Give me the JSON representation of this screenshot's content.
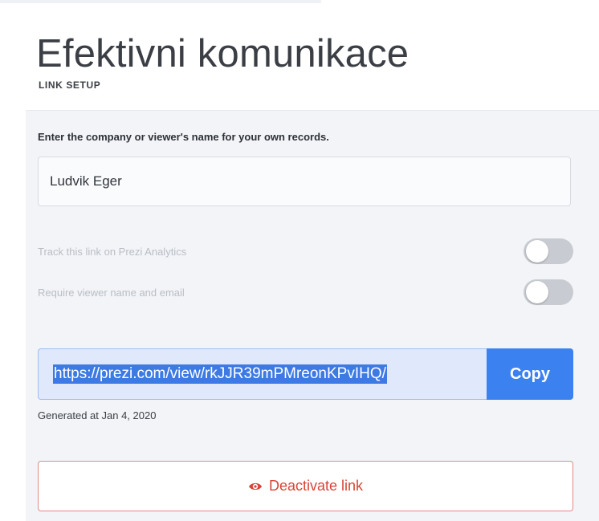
{
  "page": {
    "title": "Efektivni komunikace"
  },
  "link_setup": {
    "section_label": "LINK SETUP",
    "prompt": "Enter the company or viewer's name for your own records.",
    "name_value": "Ludvik Eger",
    "toggles": [
      {
        "label": "Track this link on Prezi Analytics",
        "state": "off"
      },
      {
        "label": "Require viewer name and email",
        "state": "off"
      }
    ],
    "link_url": "https://prezi.com/view/rkJJR39mPMreonKPvIHQ/",
    "copy_label": "Copy",
    "generated_text": "Generated at Jan 4, 2020",
    "deactivate_icon": "eye-icon",
    "deactivate_label": "Deactivate link"
  },
  "colors": {
    "accent_blue": "#3b82f0",
    "selection_blue": "#3d7ae3",
    "danger_red": "#d84436",
    "panel_background": "#f2f4f7"
  }
}
